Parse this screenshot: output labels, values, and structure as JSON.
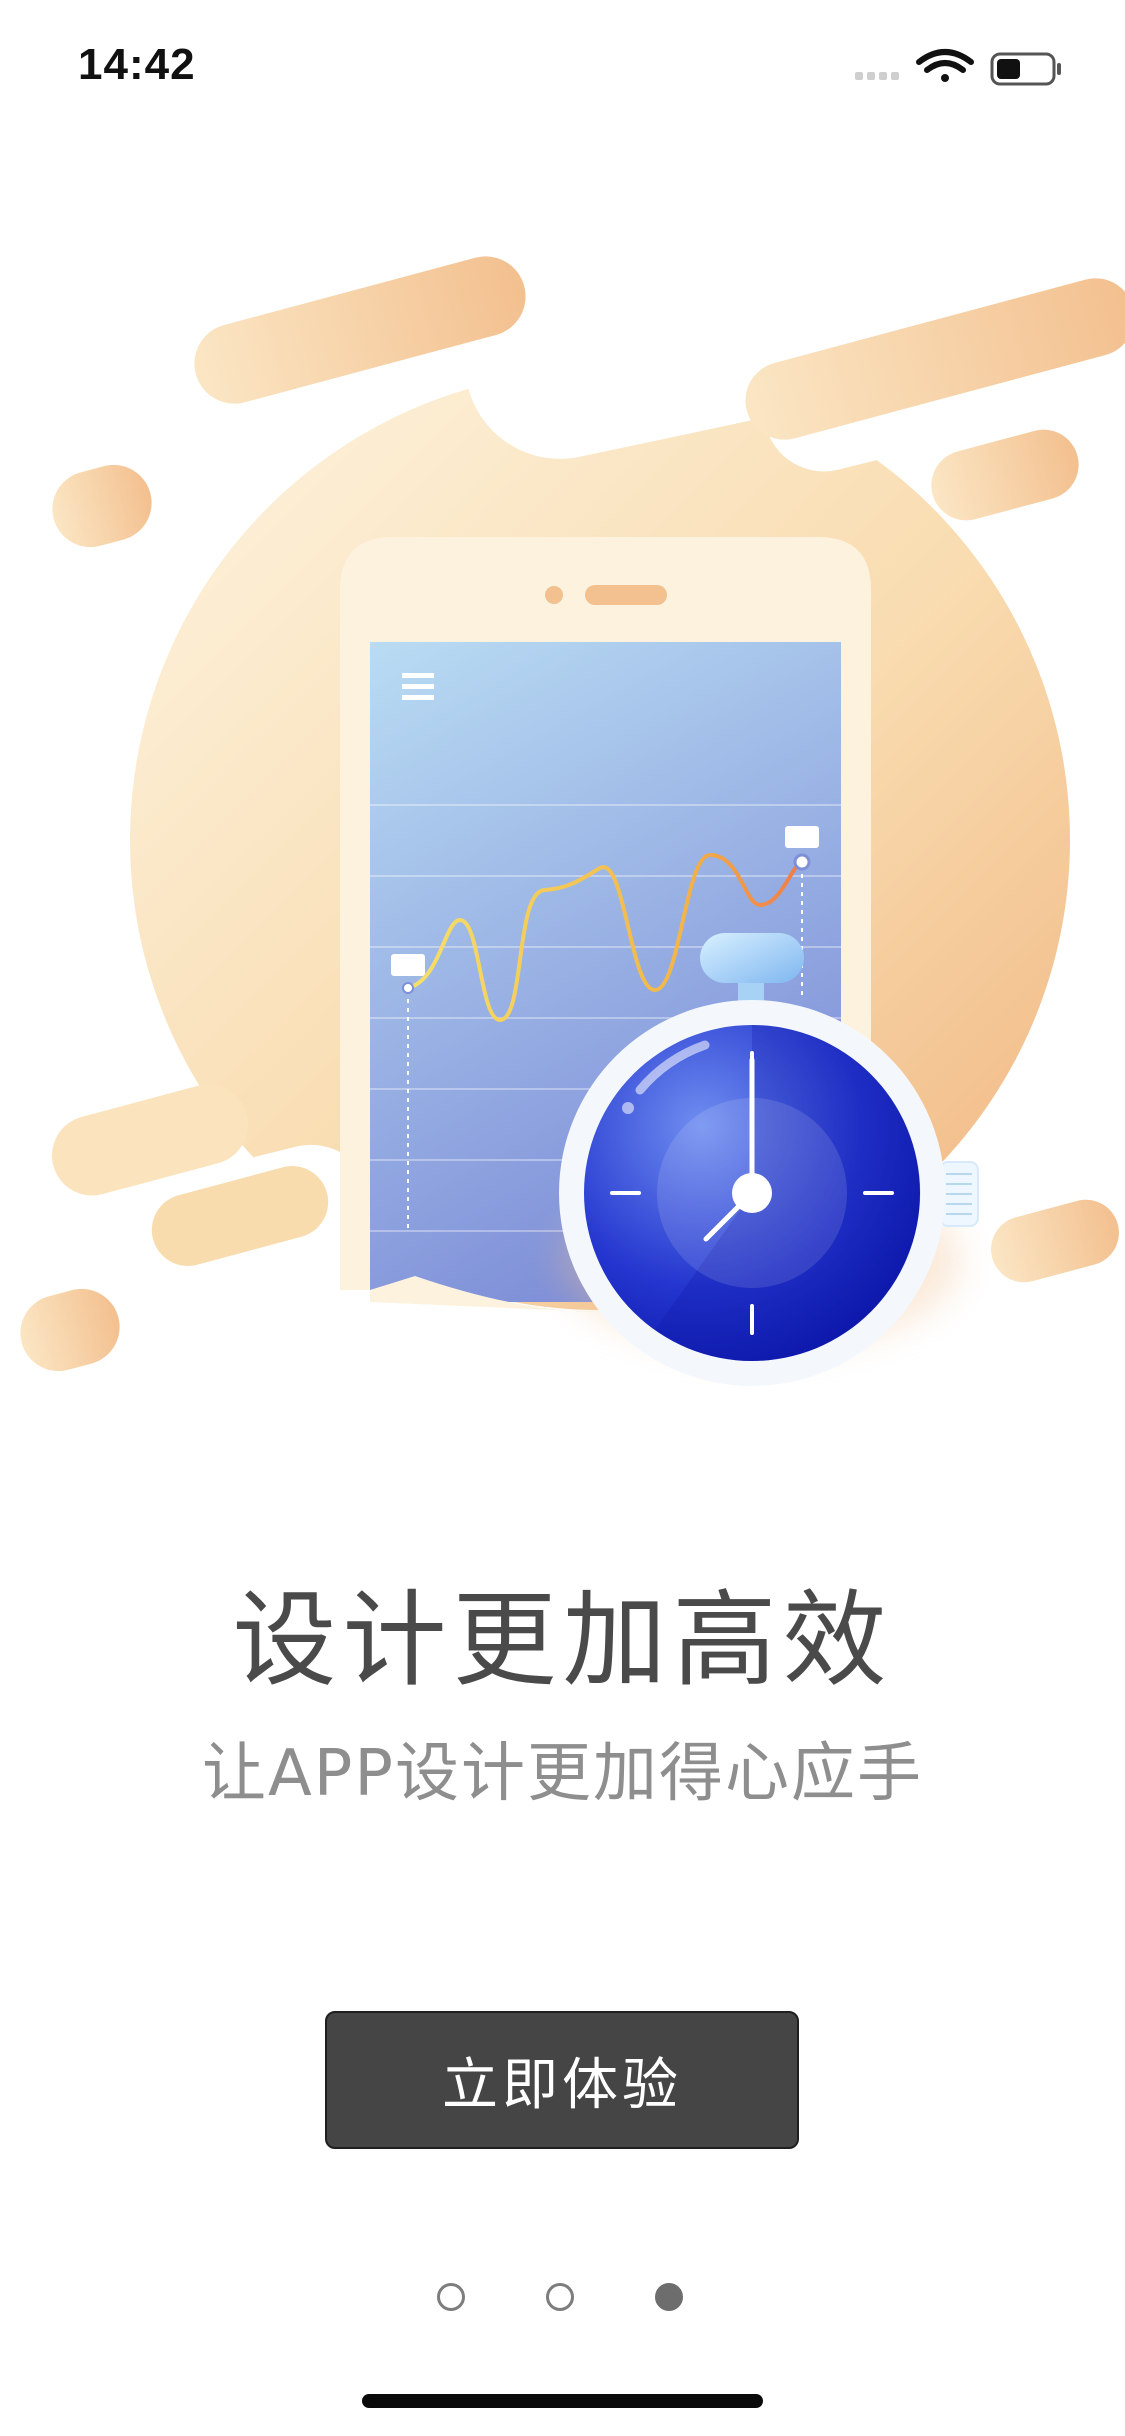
{
  "status_bar": {
    "time": "14:42",
    "icons": [
      "signal-icon",
      "wifi-icon",
      "battery-icon"
    ],
    "battery_level": 0.45
  },
  "hero": {
    "illustration": "phone-chart-stopwatch-illustration",
    "colors": {
      "blob_light": "#fdf0d8",
      "blob_dark": "#f3c08f",
      "phone_body": "#fdf2de",
      "screen_top": "#b9dcf3",
      "screen_bottom": "#7f8fd8",
      "watch_blue": "#1d2fc9",
      "line_yellow": "#f6c44c",
      "line_orange": "#f08a4b"
    }
  },
  "content": {
    "title": "设计更加高效",
    "subtitle": "让APP设计更加得心应手"
  },
  "cta": {
    "label": "立即体验",
    "background": "#454545"
  },
  "pager": {
    "pages": 3,
    "current": 3
  }
}
